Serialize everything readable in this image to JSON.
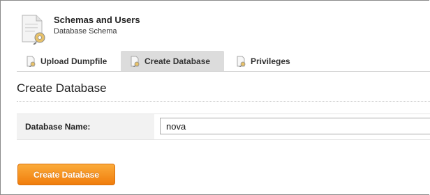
{
  "header": {
    "title": "Schemas and Users",
    "subtitle": "Database Schema",
    "icon": "document-settings-icon"
  },
  "tabs": [
    {
      "label": "Upload Dumpfile",
      "icon": "document-icon",
      "active": false
    },
    {
      "label": "Create Database",
      "icon": "document-icon",
      "active": true
    },
    {
      "label": "Privileges",
      "icon": "document-icon",
      "active": false
    }
  ],
  "section": {
    "title": "Create Database"
  },
  "form": {
    "database_name_label": "Database Name:",
    "database_name_value": "nova"
  },
  "actions": {
    "submit_label": "Create Database"
  },
  "colors": {
    "accent": "#f28a1a",
    "tab_active_bg": "#dcdcdc"
  }
}
